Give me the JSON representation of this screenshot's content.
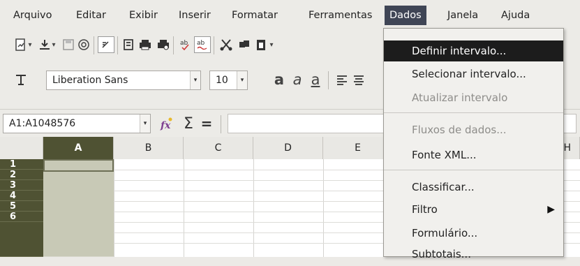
{
  "menubar": {
    "items": [
      {
        "label": "Arquivo"
      },
      {
        "label": "Editar"
      },
      {
        "label": "Exibir"
      },
      {
        "label": "Inserir"
      },
      {
        "label": "Formatar"
      },
      {
        "label": "Ferramentas"
      },
      {
        "label": "Dados"
      },
      {
        "label": "Janela"
      },
      {
        "label": "Ajuda"
      }
    ]
  },
  "toolbar": {
    "font_name": "Liberation Sans",
    "font_size": "10"
  },
  "formula": {
    "name_box": "A1:A1048576",
    "function_icon": "fx-icon",
    "sum_icon": "sigma-icon",
    "equals_label": "="
  },
  "grid": {
    "columns": [
      "A",
      "B",
      "C",
      "D",
      "E",
      "H"
    ],
    "rows": [
      "1",
      "2",
      "3",
      "4",
      "5",
      "6"
    ],
    "selected_color": "#4f5233"
  },
  "dropdown": {
    "items": [
      {
        "label": "Definir intervalo..."
      },
      {
        "label": "Selecionar intervalo..."
      },
      {
        "label": "Atualizar intervalo"
      },
      {
        "label": "Fluxos de dados..."
      },
      {
        "label": "Fonte XML..."
      },
      {
        "label": "Classificar..."
      },
      {
        "label": "Filtro"
      },
      {
        "label": "Formulário..."
      },
      {
        "label": "Subtotais..."
      }
    ]
  }
}
